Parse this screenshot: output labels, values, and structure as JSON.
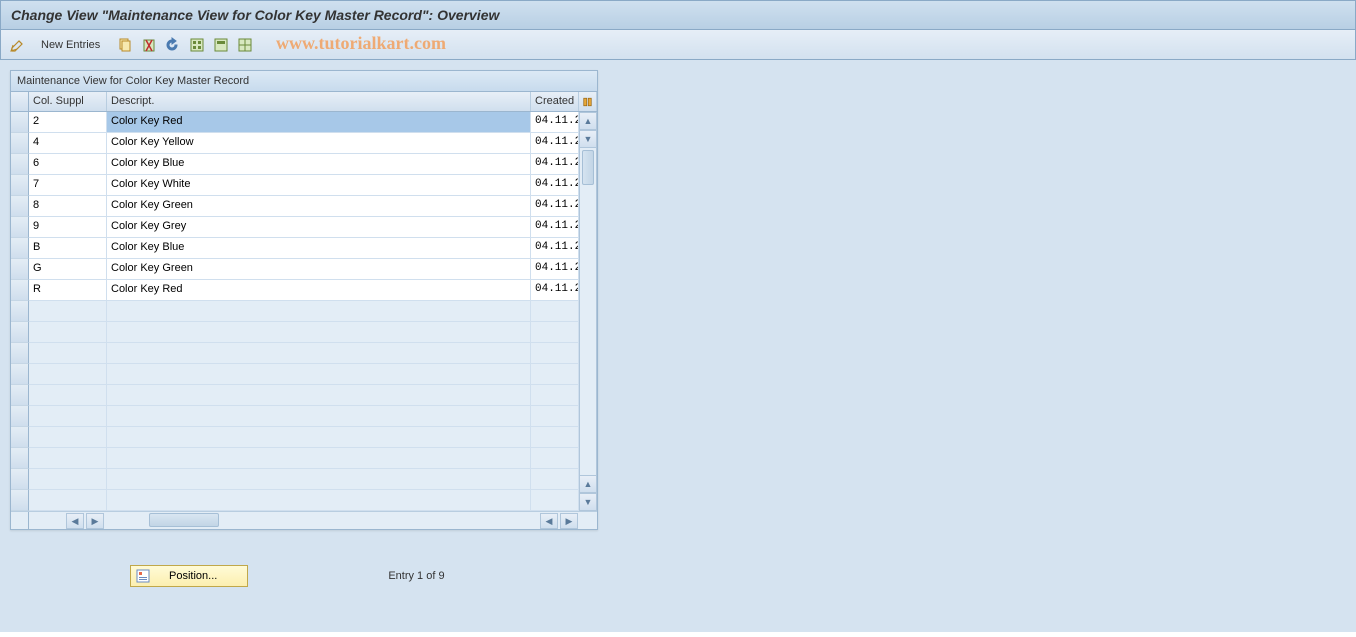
{
  "titlebar": {
    "title": "Change View \"Maintenance View for Color Key Master Record\": Overview"
  },
  "toolbar": {
    "new_entries_label": "New Entries",
    "watermark": "www.tutorialkart.com"
  },
  "table": {
    "title": "Maintenance View for Color Key Master Record",
    "columns": {
      "c0": "Col. Suppl",
      "c1": "Descript.",
      "c2": "Created"
    },
    "rows": [
      {
        "suppl": "2",
        "descript": "Color Key Red",
        "created": "04.11.2"
      },
      {
        "suppl": "4",
        "descript": "Color Key Yellow",
        "created": "04.11.2"
      },
      {
        "suppl": "6",
        "descript": "Color Key Blue",
        "created": "04.11.2"
      },
      {
        "suppl": "7",
        "descript": "Color Key White",
        "created": "04.11.2"
      },
      {
        "suppl": "8",
        "descript": "Color Key Green",
        "created": "04.11.2"
      },
      {
        "suppl": "9",
        "descript": "Color Key Grey",
        "created": "04.11.2"
      },
      {
        "suppl": "B",
        "descript": "Color Key Blue",
        "created": "04.11.2"
      },
      {
        "suppl": "G",
        "descript": "Color Key Green",
        "created": "04.11.2"
      },
      {
        "suppl": "R",
        "descript": "Color Key Red",
        "created": "04.11.2"
      }
    ],
    "empty_rows": 10
  },
  "footer": {
    "position_label": "Position...",
    "entry_text": "Entry 1 of 9"
  }
}
